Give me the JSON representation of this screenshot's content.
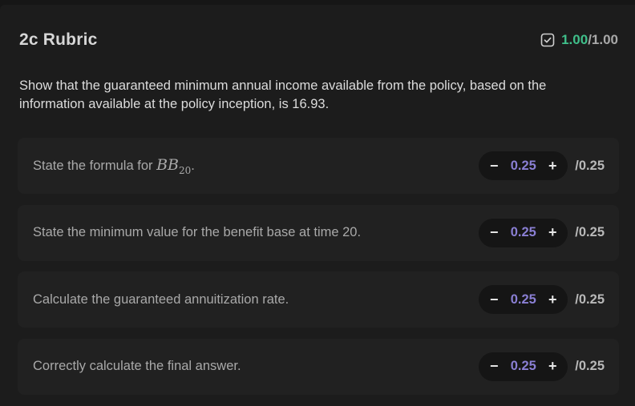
{
  "header": {
    "title": "2c Rubric",
    "score_earned": "1.00",
    "score_max": "/1.00",
    "status_icon": "checkbox-checked-icon",
    "accent_color": "#3fbf8a"
  },
  "prompt": "Show that the guaranteed minimum annual income available from the policy, based on the information available at the policy inception, is 16.93.",
  "criteria": [
    {
      "label_prefix": "State the formula for ",
      "math_base": "BB",
      "math_sub": "20",
      "label_suffix": ".",
      "value": "0.25",
      "max": "/0.25",
      "decrement": "−",
      "increment": "+"
    },
    {
      "label": "State the minimum value for the benefit base at time 20.",
      "value": "0.25",
      "max": "/0.25",
      "decrement": "−",
      "increment": "+"
    },
    {
      "label": "Calculate the guaranteed annuitization rate.",
      "value": "0.25",
      "max": "/0.25",
      "decrement": "−",
      "increment": "+"
    },
    {
      "label": "Correctly calculate the final answer.",
      "value": "0.25",
      "max": "/0.25",
      "decrement": "−",
      "increment": "+"
    }
  ]
}
